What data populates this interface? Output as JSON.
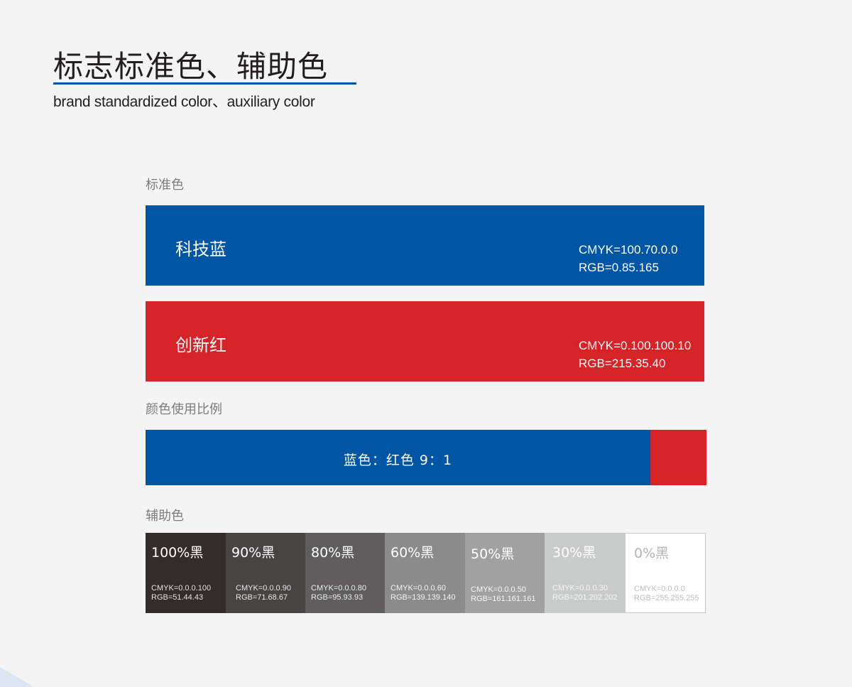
{
  "header": {
    "title": "标志标准色、辅助色",
    "subtitle": "brand standardized color、auxiliary color",
    "accent": "#0055a5"
  },
  "standard": {
    "label": "标准色",
    "colors": [
      {
        "name": "科技蓝",
        "cmyk": "CMYK=100.70.0.0",
        "rgb": "RGB=0.85.165",
        "hex": "#0055a5"
      },
      {
        "name": "创新红",
        "cmyk": "CMYK=0.100.100.10",
        "rgb": "RGB=215.35.40",
        "hex": "#d72328"
      }
    ]
  },
  "ratio": {
    "label": "颜色使用比例",
    "text": "蓝色：红色  9：1",
    "blue_share": 0.9,
    "red_share": 0.1
  },
  "auxiliary": {
    "label": "辅助色",
    "swatches": [
      {
        "name": "100%黑",
        "cmyk": "CMYK=0.0.0.100",
        "rgb": "RGB=51.44.43",
        "hex": "#332c2b",
        "text_color": "#ffffff",
        "sub_color": "#e0e0e0"
      },
      {
        "name": "90%黑",
        "cmyk": "CMYK=0.0.0.90",
        "rgb": "RGB=71.68.67",
        "hex": "#474443",
        "text_color": "#ffffff",
        "sub_color": "#e6e6e6"
      },
      {
        "name": "80%黑",
        "cmyk": "CMYK=0.0.0.80",
        "rgb": "RGB=95.93.93",
        "hex": "#5f5d5d",
        "text_color": "#ffffff",
        "sub_color": "#ececec"
      },
      {
        "name": "60%黑",
        "cmyk": "CMYK=0.0.0.60",
        "rgb": "RGB=139.139.140",
        "hex": "#8b8b8c",
        "text_color": "#ffffff",
        "sub_color": "#f2f2f2"
      },
      {
        "name": "50%黑",
        "cmyk": "CMYK=0.0.0.50",
        "rgb": "RGB=161.161.161",
        "hex": "#a1a1a1",
        "text_color": "#ffffff",
        "sub_color": "#f6f6f6"
      },
      {
        "name": "30%黑",
        "cmyk": "CMYK=0.0.0.30",
        "rgb": "RGB=201.202.202",
        "hex": "#c9caca",
        "text_color": "#ffffff",
        "sub_color": "#f6f6f6"
      },
      {
        "name": "0%黑",
        "cmyk": "CMYK=0.0.0.0",
        "rgb": "RGB=255.255.255",
        "hex": "#ffffff",
        "text_color": "#b4b4b4",
        "sub_color": "#bdbdbd"
      }
    ]
  }
}
